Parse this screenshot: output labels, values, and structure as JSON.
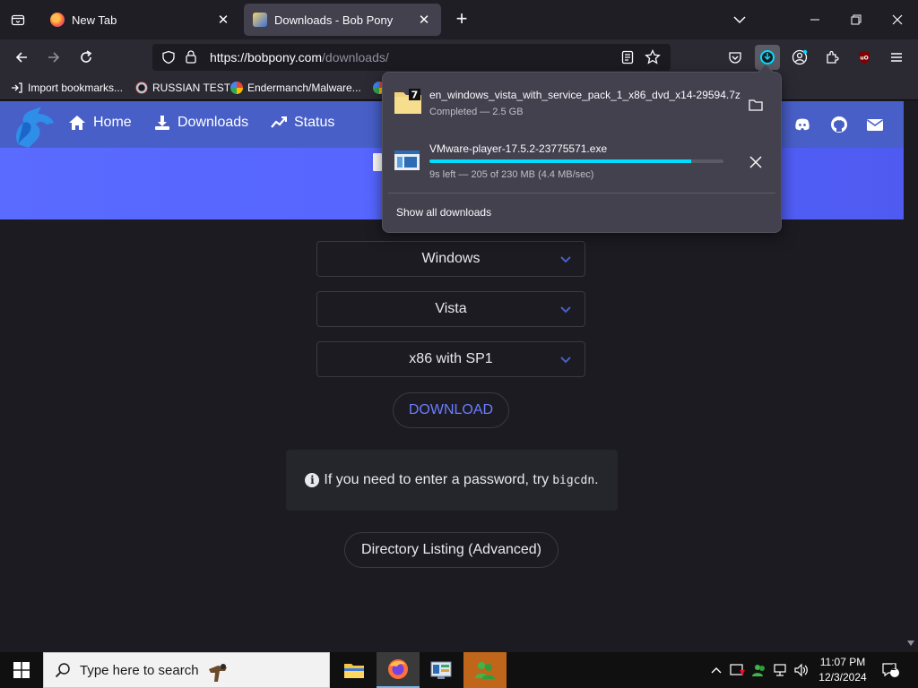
{
  "tabs": [
    {
      "label": "New Tab",
      "active": false
    },
    {
      "label": "Downloads - Bob Pony",
      "active": true
    }
  ],
  "url": {
    "host": "https://bobpony.com",
    "path": "/downloads/"
  },
  "bookmarks": [
    {
      "label": "Import bookmarks..."
    },
    {
      "label": "RUSSIAN TEST"
    },
    {
      "label": "Endermanch/Malware..."
    }
  ],
  "site_nav": {
    "home": "Home",
    "downloads": "Downloads",
    "status": "Status"
  },
  "selects": [
    {
      "value": "Windows"
    },
    {
      "value": "Vista"
    },
    {
      "value": "x86 with SP1"
    }
  ],
  "download_button": "DOWNLOAD",
  "note": {
    "text": "If you need to enter a password, try",
    "code": "bigcdn",
    "suffix": "."
  },
  "directory_button": "Directory Listing (Advanced)",
  "downloads_panel": {
    "items": [
      {
        "name": "en_windows_vista_with_service_pack_1_x86_dvd_x14-29594.7z",
        "status": "Completed — 2.5 GB"
      },
      {
        "name": "VMware-player-17.5.2-23775571.exe",
        "status": "9s left — 205 of 230 MB (4.4 MB/sec)",
        "progress": 0.89
      }
    ],
    "show_all": "Show all downloads"
  },
  "taskbar": {
    "search_placeholder": "Type here to search",
    "time": "11:07 PM",
    "date": "12/3/2024",
    "notification_count": "1"
  },
  "colors": {
    "accent": "#485fc7",
    "progress": "#00ddff",
    "link": "#6b7dff"
  }
}
